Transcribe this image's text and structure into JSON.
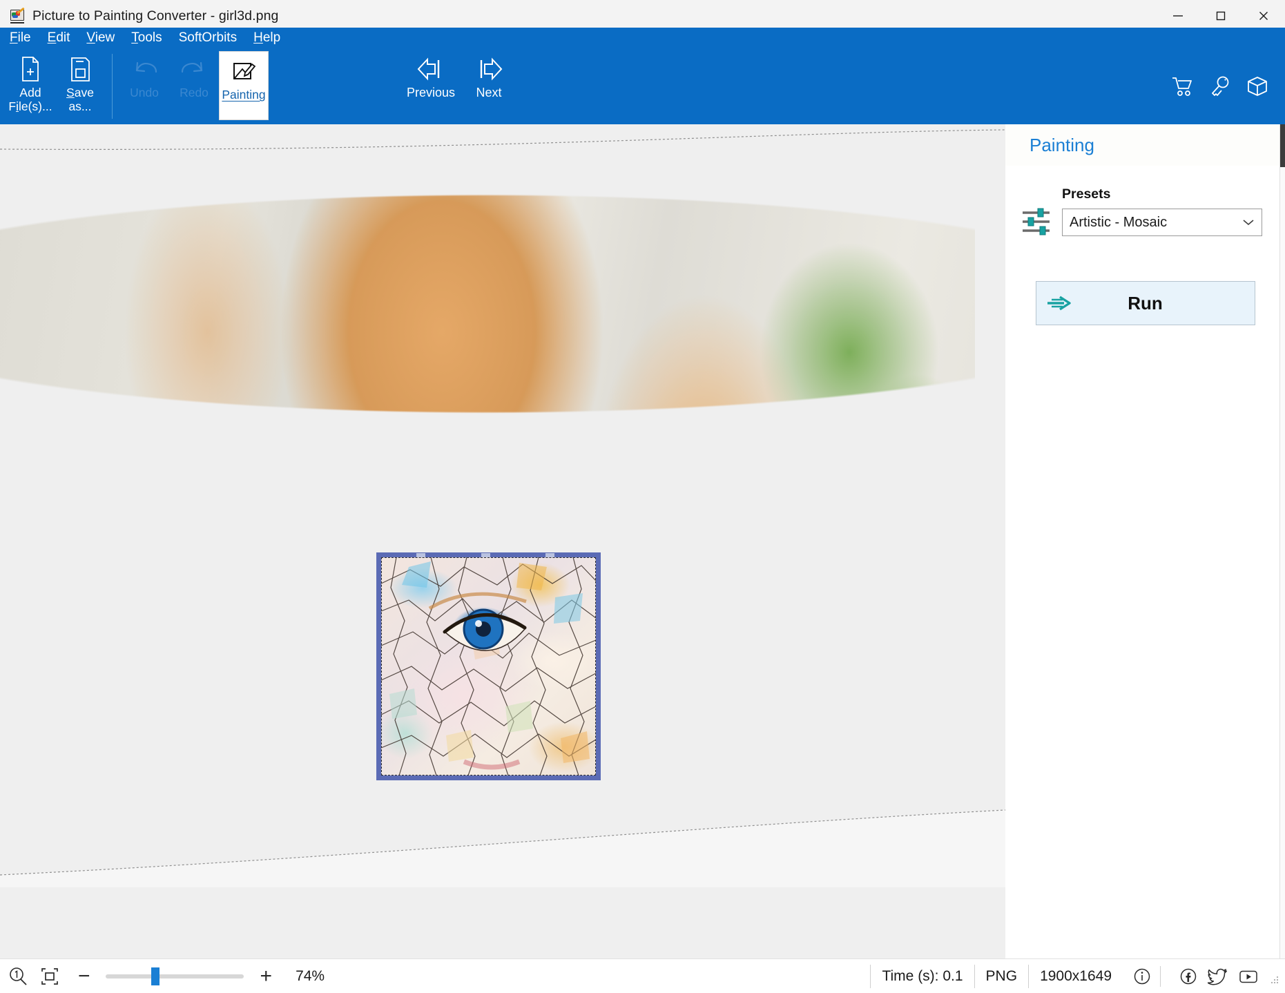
{
  "window": {
    "title": "Picture to Painting Converter - girl3d.png",
    "app_icon": "painting-app-icon",
    "minimize_label": "—",
    "maximize_label": "□",
    "close_label": "✕"
  },
  "menubar": {
    "items": [
      {
        "label": "File",
        "accel": "F"
      },
      {
        "label": "Edit",
        "accel": "E"
      },
      {
        "label": "View",
        "accel": "V"
      },
      {
        "label": "Tools",
        "accel": "T"
      },
      {
        "label": "SoftOrbits",
        "accel": ""
      },
      {
        "label": "Help",
        "accel": "H"
      }
    ]
  },
  "toolbar": {
    "add_files": {
      "line1": "Add",
      "line2": "File(s)...",
      "icon": "add-file-icon"
    },
    "save_as": {
      "line1": "Save",
      "line2": "as...",
      "icon": "save-icon"
    },
    "undo": {
      "label": "Undo",
      "icon": "undo-icon",
      "enabled": false
    },
    "redo": {
      "label": "Redo",
      "icon": "redo-icon",
      "enabled": false
    },
    "painting": {
      "label": "Painting",
      "icon": "painting-icon",
      "selected": true
    },
    "previous": {
      "label": "Previous",
      "icon": "arrow-left-icon"
    },
    "next": {
      "label": "Next",
      "icon": "arrow-right-icon"
    },
    "right_icons": [
      {
        "name": "cart-icon"
      },
      {
        "name": "key-icon"
      },
      {
        "name": "box-icon"
      }
    ]
  },
  "panel": {
    "title": "Painting",
    "presets_label": "Presets",
    "presets_icon": "sliders-icon",
    "presets_selected": "Artistic - Mosaic",
    "presets_options": [
      "Artistic - Mosaic"
    ],
    "run_label": "Run",
    "run_icon": "arrow-right-icon"
  },
  "canvas": {
    "image_name": "girl3d.png",
    "preview_overlay": "mosaic-effect-preview"
  },
  "statusbar": {
    "zoom_actual_icon": "zoom-100-icon",
    "fit_icon": "fit-to-window-icon",
    "zoom_out_label": "−",
    "zoom_in_label": "+",
    "zoom_value": "74%",
    "zoom_slider_percent": 33,
    "time_label": "Time (s): 0.1",
    "format": "PNG",
    "dimensions": "1900x1649",
    "info_icon": "info-icon",
    "facebook_icon": "facebook-icon",
    "twitter_icon": "twitter-icon",
    "youtube_icon": "youtube-icon"
  },
  "colors": {
    "ribbon_blue": "#0a6cc4",
    "accent_link": "#1a7fd4",
    "run_bg": "#e8f3fb",
    "teal": "#18a2a2",
    "selection_border": "#5b6bb5"
  }
}
